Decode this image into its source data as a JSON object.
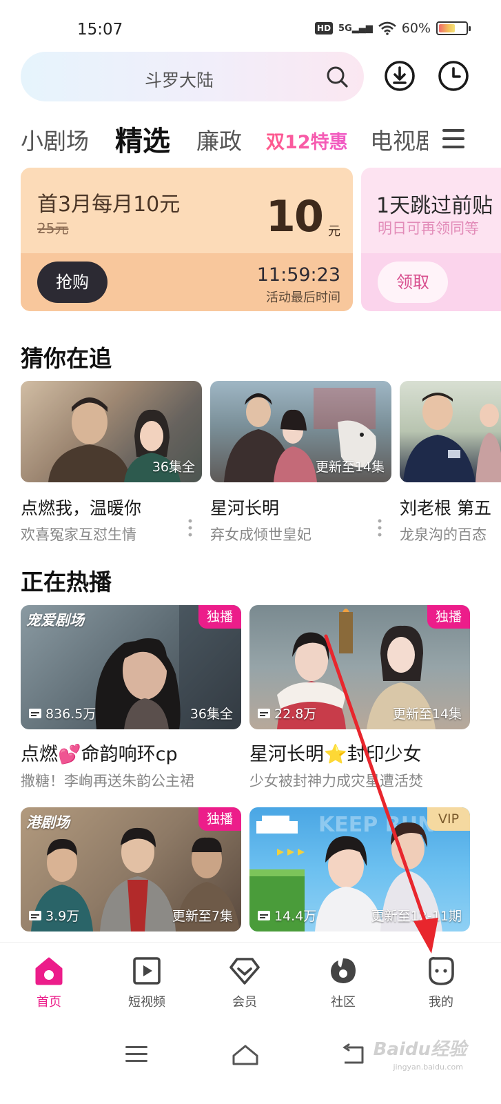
{
  "status": {
    "time": "15:07",
    "hd": "HD",
    "network": "5G",
    "battery": "60%",
    "battery_level": 0.6
  },
  "search": {
    "placeholder": "斗罗大陆"
  },
  "tabs": [
    {
      "label": "小剧场"
    },
    {
      "label": "精选"
    },
    {
      "label": "廉政"
    },
    {
      "label": "双12特惠"
    },
    {
      "label": "电视剧"
    }
  ],
  "promo": {
    "card1": {
      "title": "首3月每月10元",
      "original": "25元",
      "price": "10",
      "unit": "元",
      "button": "抢购",
      "countdown": "11:59:23",
      "countdown_label": "活动最后时间"
    },
    "card2": {
      "title": "1天跳过前贴",
      "subtitle": "明日可再领同等",
      "button": "领取"
    }
  },
  "guess": {
    "title": "猜你在追",
    "items": [
      {
        "badge": "36集全",
        "title": "点燃我，温暖你",
        "subtitle": "欢喜冤家互怼生情"
      },
      {
        "badge": "更新至14集",
        "title": "星河长明",
        "subtitle": "弃女成倾世皇妃"
      },
      {
        "badge": "",
        "title": "刘老根 第五",
        "subtitle": "龙泉沟的百态"
      }
    ]
  },
  "hot": {
    "title": "正在热播",
    "items": [
      {
        "logo": "宠爱剧场",
        "tag": "独播",
        "plays": "836.5万",
        "episodes": "36集全",
        "title": "点燃💕命韵响环cp",
        "subtitle": "撒糖！李峋再送朱韵公主裙"
      },
      {
        "logo": "",
        "tag": "独播",
        "plays": "22.8万",
        "episodes": "更新至14集",
        "title": "星河长明⭐封印少女",
        "subtitle": "少女被封神力成灾星遭活焚"
      },
      {
        "logo": "港剧场",
        "tag": "独播",
        "plays": "3.9万",
        "episodes": "更新至7集"
      },
      {
        "logo": "",
        "tag": "VIP",
        "plays": "14.4万",
        "episodes": "更新至12-11期"
      }
    ]
  },
  "nav": [
    {
      "label": "首页",
      "icon": "home-icon"
    },
    {
      "label": "短视频",
      "icon": "short-video-icon"
    },
    {
      "label": "会员",
      "icon": "vip-diamond-icon"
    },
    {
      "label": "社区",
      "icon": "community-icon"
    },
    {
      "label": "我的",
      "icon": "profile-icon"
    }
  ],
  "watermark": {
    "text": "Baidu经验",
    "url": "jingyan.baidu.com"
  },
  "colors": {
    "accent": "#ec1d8a",
    "annotation": "#e8262d"
  }
}
